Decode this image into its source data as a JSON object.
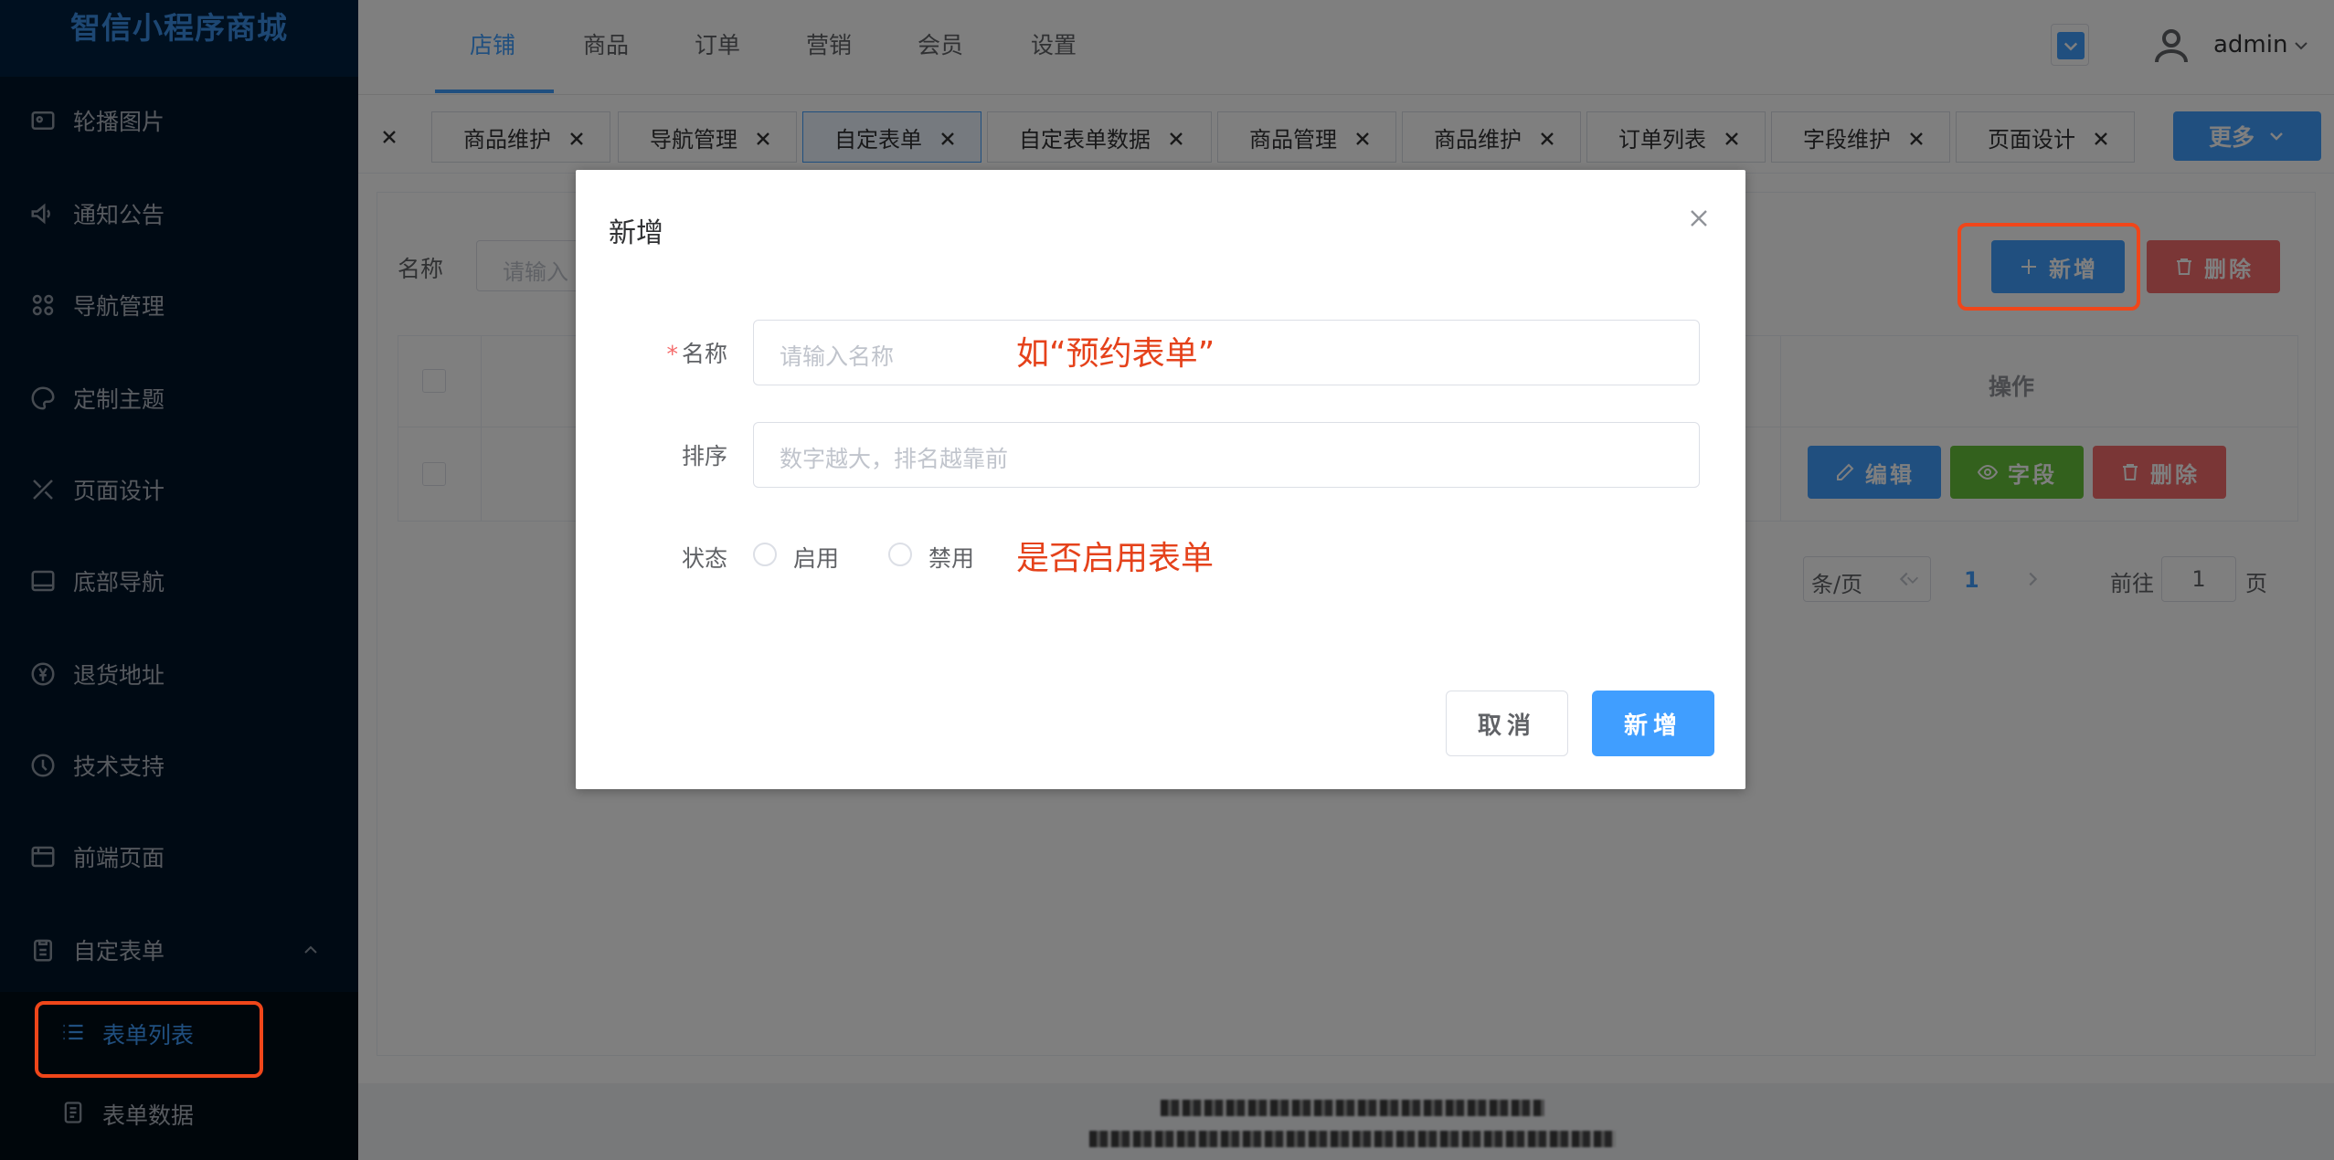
{
  "brand": "智信小程序商城",
  "sidebar": {
    "items": [
      {
        "label": "轮播图片",
        "icon": "image-icon"
      },
      {
        "label": "通知公告",
        "icon": "megaphone-icon"
      },
      {
        "label": "导航管理",
        "icon": "grid-icon"
      },
      {
        "label": "定制主题",
        "icon": "palette-icon"
      },
      {
        "label": "页面设计",
        "icon": "tools-icon"
      },
      {
        "label": "底部导航",
        "icon": "footer-bar-icon"
      },
      {
        "label": "退货地址",
        "icon": "yen-icon"
      },
      {
        "label": "技术支持",
        "icon": "support-icon"
      },
      {
        "label": "前端页面",
        "icon": "window-icon"
      },
      {
        "label": "自定表单",
        "icon": "clipboard-icon"
      }
    ],
    "sub_items": [
      {
        "label": "表单列表",
        "icon": "list-icon",
        "active": true
      },
      {
        "label": "表单数据",
        "icon": "document-icon",
        "active": false
      }
    ]
  },
  "topnav": {
    "tabs": [
      "店铺",
      "商品",
      "订单",
      "营销",
      "会员",
      "设置"
    ],
    "active_tab": "店铺",
    "user": "admin"
  },
  "tags": [
    "商品维护",
    "导航管理",
    "自定表单",
    "自定表单数据",
    "商品管理",
    "商品维护",
    "订单列表",
    "字段维护",
    "页面设计"
  ],
  "active_tag": "自定表单",
  "more_label": "更多",
  "filter": {
    "label": "名称",
    "placeholder": "请输入"
  },
  "toolbar": {
    "add_label": "新增",
    "delete_label": "删除"
  },
  "table": {
    "ops_header": "操作",
    "row_actions": {
      "edit": "编辑",
      "fields": "字段",
      "delete": "删除"
    }
  },
  "pager": {
    "page_size_suffix": "条/页",
    "current_page": "1",
    "goto_prefix": "前往",
    "goto_value": "1",
    "goto_suffix": "页"
  },
  "dialog": {
    "title": "新增",
    "name_label": "名称",
    "name_placeholder": "请输入名称",
    "name_annotation": "如“预约表单”",
    "sort_label": "排序",
    "sort_placeholder": "数字越大，排名越靠前",
    "status_label": "状态",
    "status_options": [
      "启用",
      "禁用"
    ],
    "status_annotation": "是否启用表单",
    "cancel_label": "取消",
    "ok_label": "新增"
  },
  "colors": {
    "primary": "#409eff",
    "danger": "#f56c6c",
    "success": "#67c23a",
    "sidebar_bg": "#001529",
    "annotation": "#e5421b"
  }
}
